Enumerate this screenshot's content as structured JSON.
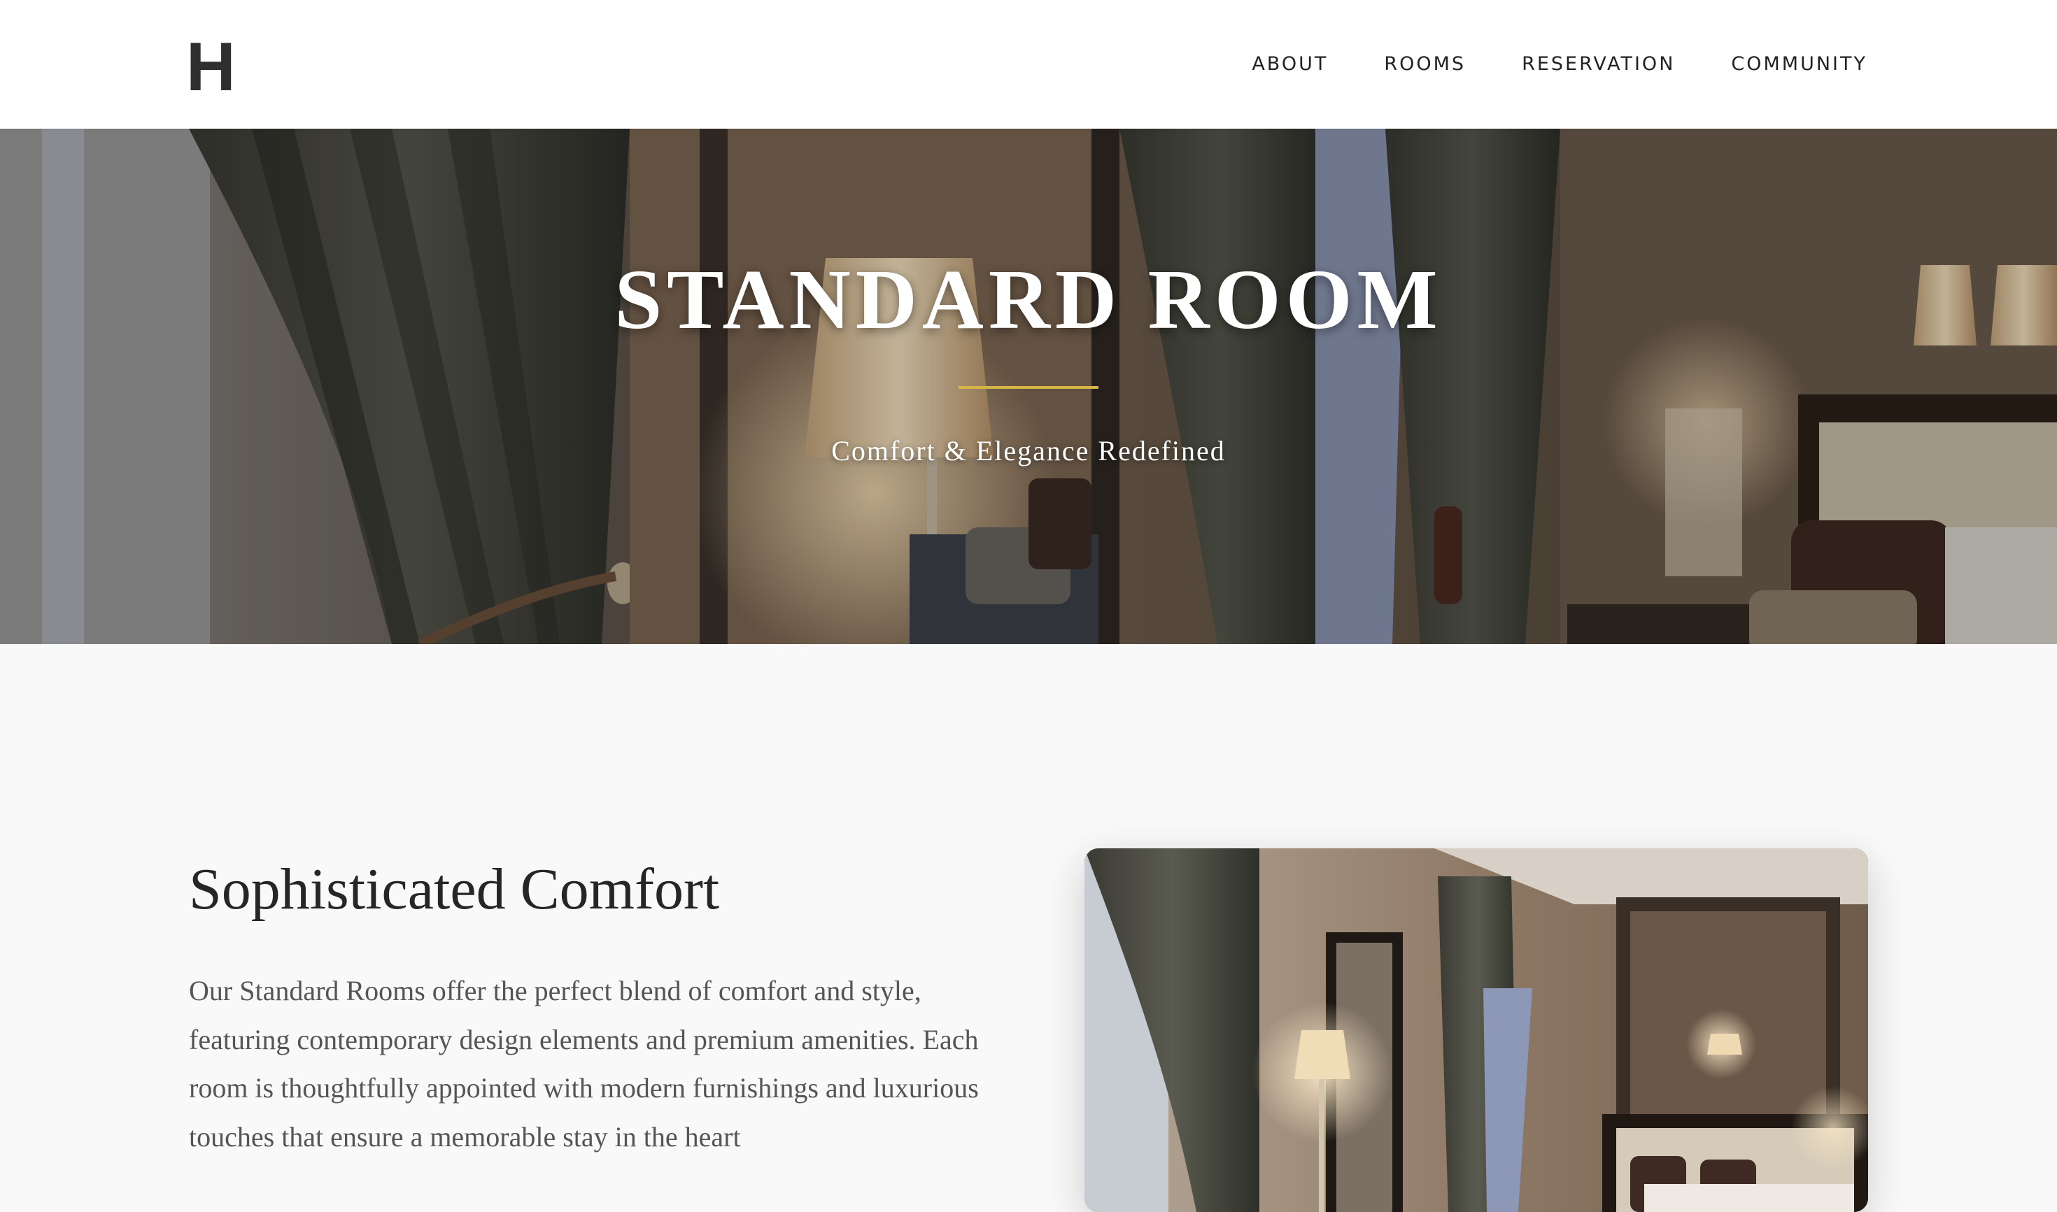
{
  "header": {
    "logo": "H",
    "nav": [
      {
        "label": "ABOUT"
      },
      {
        "label": "ROOMS"
      },
      {
        "label": "RESERVATION"
      },
      {
        "label": "COMMUNITY"
      }
    ]
  },
  "hero": {
    "title": "STANDARD ROOM",
    "subtitle": "Comfort & Elegance Redefined",
    "accent_color": "#d6b548"
  },
  "content": {
    "heading": "Sophisticated Comfort",
    "body": "Our Standard Rooms offer the perfect blend of comfort and style, featuring contemporary design elements and premium amenities. Each room is thoughtfully appointed with modern furnishings and luxurious touches that ensure a memorable stay in the heart"
  }
}
